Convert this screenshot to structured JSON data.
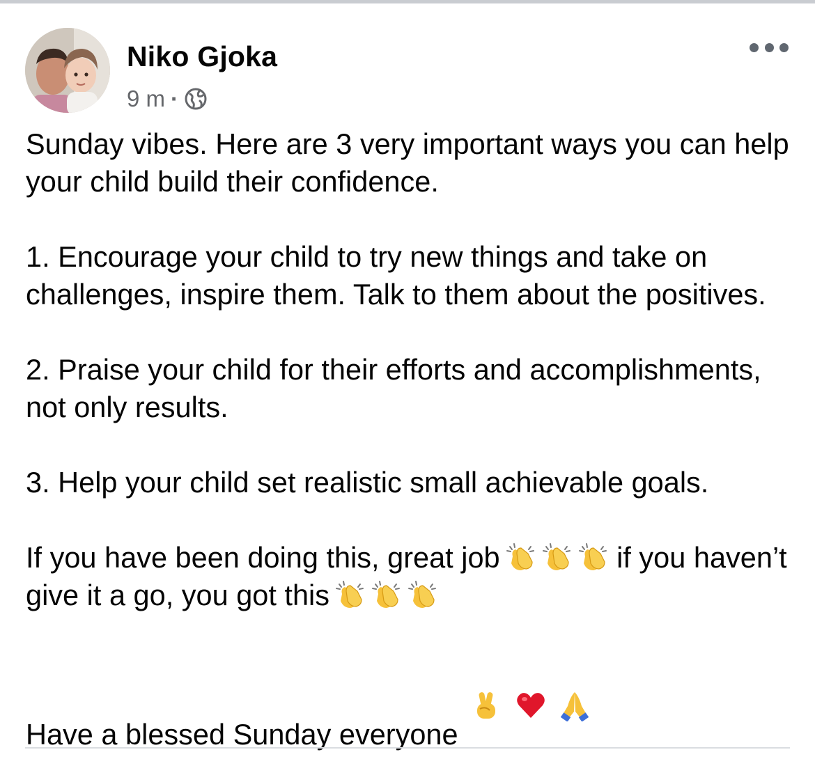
{
  "post": {
    "author": "Niko Gjoka",
    "time": "9 m",
    "separator": "·",
    "audience_icon": "globe-icon",
    "more_icon": "more-options-icon",
    "paragraphs": {
      "p1": "Sunday vibes. Here are 3 very important ways you can help your child build their confidence.",
      "p2": "1. Encourage your child to try new things and take on challenges, inspire them. Talk to them about the positives.",
      "p3": "2. Praise your child for their efforts and accomplishments, not only results.",
      "p4": "3. Help your child set realistic small achievable goals.",
      "p5a": "If you have been doing this, great job",
      "p5b": "if you haven’t give it a go, you got this",
      "p6": "Have a blessed Sunday everyone"
    },
    "emojis": {
      "clap": "clapping-hands-emoji",
      "victory": "victory-hand-emoji",
      "heart": "red-heart-emoji",
      "pray": "folded-hands-emoji"
    }
  },
  "colors": {
    "text": "#050505",
    "secondary_text": "#65676b",
    "divider": "#dadde1"
  }
}
